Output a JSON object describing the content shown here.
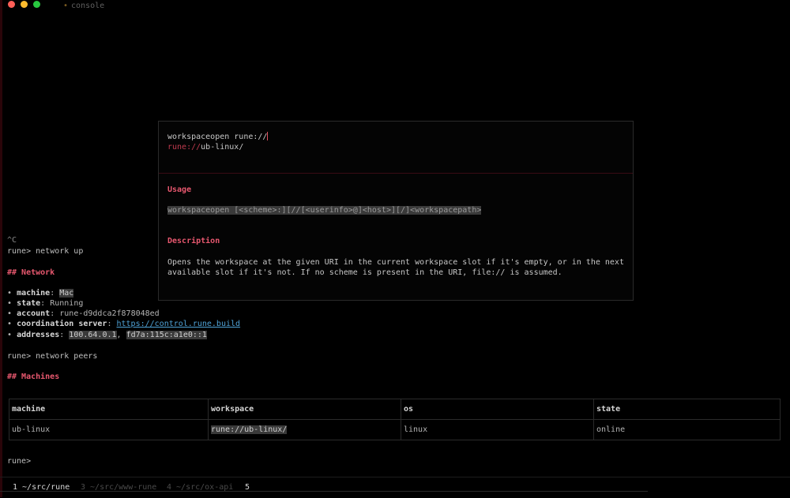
{
  "window": {
    "title": "console"
  },
  "terminal": {
    "interrupt": "^C",
    "prompt": "rune>",
    "cmd_network_up": "network up",
    "network_heading": "## Network",
    "bullet": "•",
    "network_fields": {
      "machine_key": "machine",
      "machine_val": "Mac",
      "state_key": "state",
      "state_val": "Running",
      "account_key": "account",
      "account_val": "rune-d9ddca2f878048ed",
      "coord_key": "coordination server",
      "coord_val": "https://control.rune.build",
      "addr_key": "addresses",
      "addr_v4": "100.64.0.1",
      "addr_sep": ",",
      "addr_v6": "fd7a:115c:a1e0::1"
    },
    "cmd_network_peers": "network peers",
    "machines_heading": "## Machines",
    "table": {
      "headers": [
        "machine",
        "workspace",
        "os",
        "state"
      ],
      "rows": [
        [
          "ub-linux",
          "rune://ub-linux/",
          "linux",
          "online"
        ]
      ]
    },
    "final_prompt": "rune>"
  },
  "popup": {
    "input_text": "workspaceopen rune://",
    "suggestion_prefix": "rune://",
    "suggestion_rest": "ub-linux/",
    "usage_heading": "Usage",
    "usage_code": "workspaceopen [<scheme>:][//[<userinfo>@]<host>][/]<workspacepath>",
    "description_heading": "Description",
    "description_line1": "Opens the workspace at the given URI in the current workspace slot if it's empty, or in the next",
    "description_line2": "available slot if it's not. If no scheme is present in the URI, file:// is assumed."
  },
  "statusbar": {
    "tabs": [
      {
        "label": "1 ~/src/rune",
        "active": true
      },
      {
        "label": "3 ~/src/www-rune",
        "active": false
      },
      {
        "label": "4 ~/src/ox-api",
        "active": false
      },
      {
        "label": "5",
        "active": true
      }
    ]
  },
  "colors": {
    "background": "#000000",
    "heading": "#e8586f",
    "link": "#4fa3d8",
    "highlight_bg": "#3a3a3a",
    "traffic_red": "#ff5f57",
    "traffic_yellow": "#febc2e",
    "traffic_green": "#28c840"
  }
}
